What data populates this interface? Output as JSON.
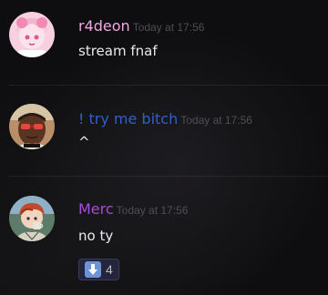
{
  "messages": [
    {
      "username": "r4deon",
      "username_color": "#f0a8e6",
      "timestamp": "Today at 17:56",
      "text": "stream fnaf",
      "avatar": "anime-girl-avatar"
    },
    {
      "username": "! try me bitch",
      "username_color": "#2f5fcf",
      "timestamp": "Today at 17:56",
      "text": "^",
      "avatar": "man-red-glasses-avatar"
    },
    {
      "username": "Merc",
      "username_color": "#a64cd6",
      "timestamp": "Today at 17:56",
      "text": "no ty",
      "avatar": "anime-boy-avatar",
      "reaction": {
        "emoji": "down-arrow-emoji",
        "count": "4"
      }
    }
  ]
}
